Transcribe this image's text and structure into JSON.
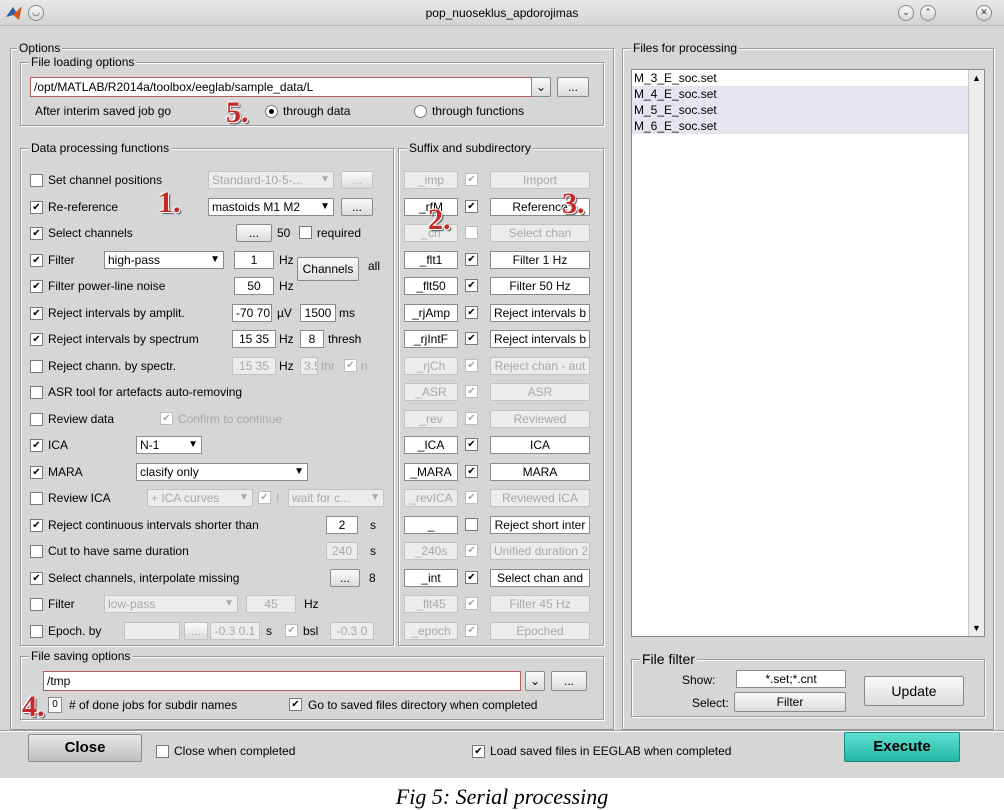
{
  "window": {
    "title": "pop_nuoseklus_apdorojimas"
  },
  "options": {
    "title": "Options"
  },
  "file_loading": {
    "title": "File loading options",
    "path": "/opt/MATLAB/R2014a/toolbox/eeglab/sample_data/L",
    "browse": "...",
    "after_label": "After interim saved job go",
    "through_data": "through data",
    "through_functions": "through functions"
  },
  "processing": {
    "title": "Data processing functions",
    "rows": [
      {
        "label": "Set channel positions",
        "checked": false
      },
      {
        "label": "Re-reference",
        "checked": true
      },
      {
        "label": "Select channels",
        "checked": true
      },
      {
        "label": "Filter",
        "checked": true
      },
      {
        "label": "Filter power-line noise",
        "checked": true
      },
      {
        "label": "Reject intervals by amplit.",
        "checked": true
      },
      {
        "label": "Reject intervals by spectrum",
        "checked": true
      },
      {
        "label": "Reject chann. by spectr.",
        "checked": false
      },
      {
        "label": "ASR tool for artefacts auto-removing",
        "checked": false
      },
      {
        "label": "Review data",
        "checked": false
      },
      {
        "label": "ICA",
        "checked": true
      },
      {
        "label": "MARA",
        "checked": true
      },
      {
        "label": "Review ICA",
        "checked": false
      },
      {
        "label": "Reject continuous intervals shorter than",
        "checked": true
      },
      {
        "label": "Cut to have same duration",
        "checked": false
      },
      {
        "label": "Select channels, interpolate missing",
        "checked": true
      },
      {
        "label": "Filter",
        "checked": false
      },
      {
        "label": "Epoch. by",
        "checked": false
      }
    ],
    "ctrl": {
      "chanpos_select": "Standard-10-5-...",
      "reref_select": "mastoids M1 M2",
      "btn": "...",
      "sel_count": "50",
      "sel_required": "required",
      "filter_type": "high-pass",
      "filter_value": "1",
      "hz": "Hz",
      "channels_btn": "Channels",
      "all": "all",
      "notch_value": "50",
      "amp_value": "-70 70",
      "uv": "µV",
      "amp_ms_value": "1500",
      "ms": "ms",
      "spec_value": "15 35",
      "spec_thresh": "8",
      "thresh": "thresh",
      "chspec_value": "15 35",
      "chspec_thr": "3.5",
      "thr": "thr",
      "n": "n",
      "confirm": "Confirm to continue",
      "ica_select": "N-1",
      "mara_select": "clasify only",
      "rica_curves": "+ ICA curves",
      "rica_excl": "!",
      "rica_wait": "wait for c...",
      "short_value": "2",
      "s": "s",
      "dur_value": "240",
      "interp_count": "8",
      "filter2_type": "low-pass",
      "filter2_value": "45",
      "epoch_value": "",
      "epoch_range": "-0.3 0.1",
      "bsl": "bsl",
      "bsl_range": "-0.3 0"
    }
  },
  "suffix": {
    "title": "Suffix and subdirectory",
    "rows": [
      {
        "suffix": "_imp",
        "checked": true,
        "enabled": false,
        "name": "Import"
      },
      {
        "suffix": "_rfM",
        "checked": true,
        "enabled": true,
        "name": "Reference"
      },
      {
        "suffix": "_ch",
        "checked": false,
        "enabled": false,
        "name": "Select chan"
      },
      {
        "suffix": "_flt1",
        "checked": true,
        "enabled": true,
        "name": "Filter 1 Hz"
      },
      {
        "suffix": "_flt50",
        "checked": true,
        "enabled": true,
        "name": "Filter 50 Hz"
      },
      {
        "suffix": "_rjAmp",
        "checked": true,
        "enabled": true,
        "name": "Reject intervals b"
      },
      {
        "suffix": "_rjIntF",
        "checked": true,
        "enabled": true,
        "name": "Reject intervals b"
      },
      {
        "suffix": "_rjCh",
        "checked": true,
        "enabled": false,
        "name": "Reject chan - aut"
      },
      {
        "suffix": "_ASR",
        "checked": true,
        "enabled": false,
        "name": "ASR"
      },
      {
        "suffix": "_rev",
        "checked": true,
        "enabled": false,
        "name": "Reviewed"
      },
      {
        "suffix": "_ICA",
        "checked": true,
        "enabled": true,
        "name": "ICA"
      },
      {
        "suffix": "_MARA",
        "checked": true,
        "enabled": true,
        "name": "MARA"
      },
      {
        "suffix": "_revICA",
        "checked": true,
        "enabled": false,
        "name": "Reviewed ICA"
      },
      {
        "suffix": "_",
        "checked": false,
        "enabled": true,
        "name": "Reject short inter"
      },
      {
        "suffix": "_240s",
        "checked": true,
        "enabled": false,
        "name": "Unified duration 2"
      },
      {
        "suffix": "_int",
        "checked": true,
        "enabled": true,
        "name": "Select chan and"
      },
      {
        "suffix": "_flt45",
        "checked": true,
        "enabled": false,
        "name": "Filter 45 Hz"
      },
      {
        "suffix": "_epoch",
        "checked": true,
        "enabled": false,
        "name": "Epoched"
      }
    ]
  },
  "saving": {
    "title": "File saving options",
    "path": "/tmp",
    "browse": "...",
    "jobs_count": "0",
    "jobs_label": "# of done jobs for subdir names",
    "goto_label": "Go to saved files directory when completed"
  },
  "files": {
    "title": "Files for processing",
    "items": [
      "M_3_E_soc.set",
      "M_4_E_soc.set",
      "M_5_E_soc.set",
      "M_6_E_soc.set"
    ]
  },
  "filter_panel": {
    "title": "File filter",
    "show_label": "Show:",
    "show_value": "*.set;*.cnt",
    "select_label": "Select:",
    "filter_btn": "Filter",
    "update_btn": "Update"
  },
  "footer": {
    "close": "Close",
    "close_when": "Close when completed",
    "load_saved": "Load saved files in EEGLAB when completed",
    "execute": "Execute"
  },
  "markers": {
    "m1": "1.",
    "m2": "2.",
    "m3": "3.",
    "m4": "4.",
    "m5": "5."
  },
  "caption": "Fig 5: Serial processing"
}
